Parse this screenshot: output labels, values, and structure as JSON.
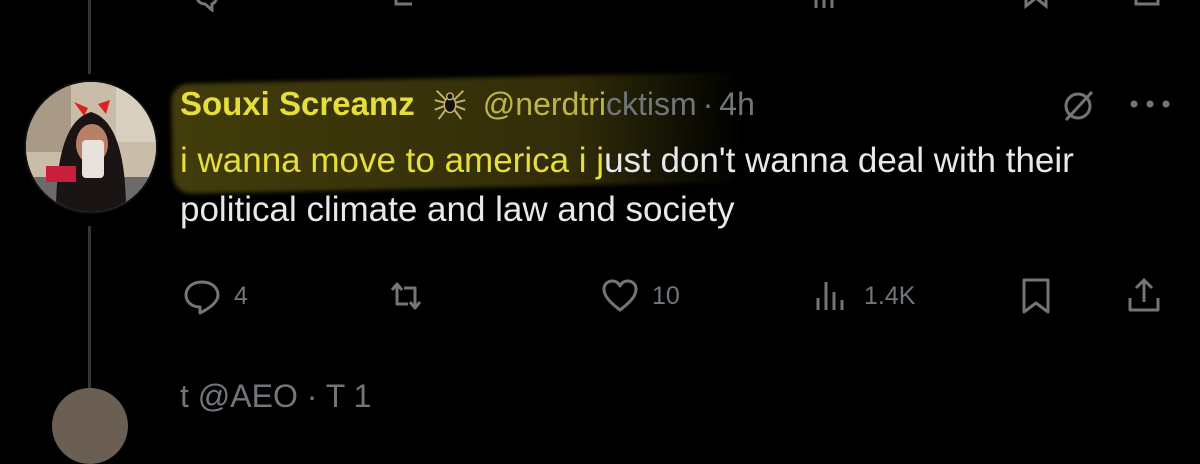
{
  "tweet": {
    "display_name": "Souxi Screamz",
    "handle_highlighted": "@nerdtri",
    "handle_rest": "cktism",
    "separator": "·",
    "time": "4h",
    "text_highlighted": "i wanna move to america i j",
    "text_rest": "ust don't wanna deal with their political climate and law and society",
    "metrics": {
      "replies": "4",
      "likes": "10",
      "views": "1.4K"
    }
  },
  "next_tweet": {
    "partial_text": "t        @AEO · T     1"
  },
  "colors": {
    "background": "#000000",
    "highlight": "#e6de3a",
    "secondary_text": "#71767b",
    "thread_line": "#333639"
  },
  "icons": {
    "badge": "spider-icon",
    "grok": "grok-slash-icon",
    "more": "more-dots-icon",
    "reply": "reply-icon",
    "repost": "repost-icon",
    "like": "heart-icon",
    "views": "views-bars-icon",
    "bookmark": "bookmark-icon",
    "share": "share-icon"
  }
}
